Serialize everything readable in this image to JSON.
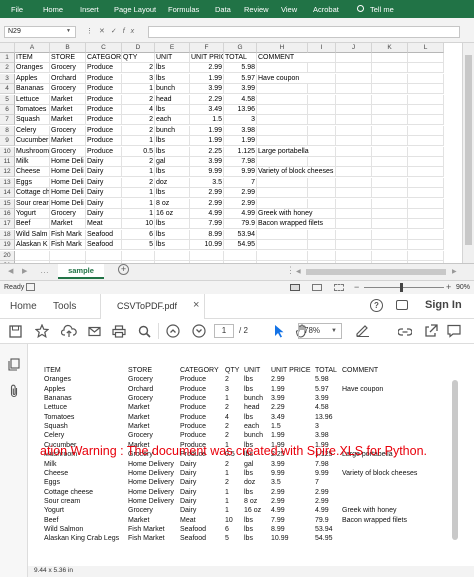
{
  "excel": {
    "ribbon_tabs": [
      "File",
      "Home",
      "Insert",
      "Page Layout",
      "Formulas",
      "Data",
      "Review",
      "View",
      "Acrobat"
    ],
    "tell_me": "Tell me",
    "name_box": "N29",
    "columns": [
      "A",
      "B",
      "C",
      "D",
      "E",
      "F",
      "G",
      "H",
      "I",
      "J",
      "K",
      "L"
    ],
    "row_numbers": [
      "1",
      "2",
      "3",
      "4",
      "5",
      "6",
      "7",
      "8",
      "9",
      "10",
      "11",
      "12",
      "13",
      "14",
      "15",
      "16",
      "17",
      "18",
      "19",
      "20",
      "21"
    ],
    "rows": [
      [
        "ITEM",
        "STORE",
        "CATEGORY",
        "QTY",
        "UNIT",
        "UNIT PRICE",
        "TOTAL",
        "COMMENT"
      ],
      [
        "Oranges",
        "Grocery",
        "Produce",
        "2",
        "lbs",
        "2.99",
        "5.98",
        ""
      ],
      [
        "Apples",
        "Orchard",
        "Produce",
        "3",
        "lbs",
        "1.99",
        "5.97",
        "Have coupon"
      ],
      [
        "Bananas",
        "Grocery",
        "Produce",
        "1",
        "bunch",
        "3.99",
        "3.99",
        ""
      ],
      [
        "Lettuce",
        "Market",
        "Produce",
        "2",
        "head",
        "2.29",
        "4.58",
        ""
      ],
      [
        "Tomatoes",
        "Market",
        "Produce",
        "4",
        "lbs",
        "3.49",
        "13.96",
        ""
      ],
      [
        "Squash",
        "Market",
        "Produce",
        "2",
        "each",
        "1.5",
        "3",
        ""
      ],
      [
        "Celery",
        "Grocery",
        "Produce",
        "2",
        "bunch",
        "1.99",
        "3.98",
        ""
      ],
      [
        "Cucumber",
        "Market",
        "Produce",
        "1",
        "lbs",
        "1.99",
        "1.99",
        ""
      ],
      [
        "Mushroom",
        "Grocery",
        "Produce",
        "0.5",
        "lbs",
        "2.25",
        "1.125",
        "Large portabella"
      ],
      [
        "Milk",
        "Home Deli",
        "Dairy",
        "2",
        "gal",
        "3.99",
        "7.98",
        ""
      ],
      [
        "Cheese",
        "Home Deli",
        "Dairy",
        "1",
        "lbs",
        "9.99",
        "9.99",
        "Variety of block cheeses"
      ],
      [
        "Eggs",
        "Home Deli",
        "Dairy",
        "2",
        "doz",
        "3.5",
        "7",
        ""
      ],
      [
        "Cottage ch",
        "Home Deli",
        "Dairy",
        "1",
        "lbs",
        "2.99",
        "2.99",
        ""
      ],
      [
        "Sour crear",
        "Home Deli",
        "Dairy",
        "1",
        "8 oz",
        "2.99",
        "2.99",
        ""
      ],
      [
        "Yogurt",
        "Grocery",
        "Dairy",
        "1",
        "16 oz",
        "4.99",
        "4.99",
        "Greek with honey"
      ],
      [
        "Beef",
        "Market",
        "Meat",
        "10",
        "lbs",
        "7.99",
        "79.9",
        "Bacon wrapped filets"
      ],
      [
        "Wild Salm",
        "Fish Mark",
        "Seafood",
        "6",
        "lbs",
        "8.99",
        "53.94",
        ""
      ],
      [
        "Alaskan K",
        "Fish Mark",
        "Seafood",
        "5",
        "lbs",
        "10.99",
        "54.95",
        ""
      ],
      [
        "",
        "",
        "",
        "",
        "",
        "",
        "",
        ""
      ],
      [
        "",
        "",
        "",
        "",
        "",
        "",
        "",
        ""
      ]
    ],
    "sheet_tab": "sample",
    "status": "Ready",
    "zoom": "90%"
  },
  "pdf": {
    "nav": {
      "home": "Home",
      "tools": "Tools",
      "file_tab": "CSVToPDF.pdf",
      "sign_in": "Sign In"
    },
    "page_current": "1",
    "page_total": "/ 2",
    "zoom": "78%",
    "headers": [
      "ITEM",
      "STORE",
      "CATEGORY",
      "QTY",
      "UNIT",
      "UNIT PRICE",
      "TOTAL",
      "COMMENT"
    ],
    "rows": [
      [
        "Oranges",
        "Grocery",
        "Produce",
        "2",
        "lbs",
        "2.99",
        "5.98",
        ""
      ],
      [
        "Apples",
        "Orchard",
        "Produce",
        "3",
        "lbs",
        "1.99",
        "5.97",
        "Have coupon"
      ],
      [
        "Bananas",
        "Grocery",
        "Produce",
        "1",
        "bunch",
        "3.99",
        "3.99",
        ""
      ],
      [
        "Lettuce",
        "Market",
        "Produce",
        "2",
        "head",
        "2.29",
        "4.58",
        ""
      ],
      [
        "Tomatoes",
        "Market",
        "Produce",
        "4",
        "lbs",
        "3.49",
        "13.96",
        ""
      ],
      [
        "Squash",
        "Market",
        "Produce",
        "2",
        "each",
        "1.5",
        "3",
        ""
      ],
      [
        "Celery",
        "Grocery",
        "Produce",
        "2",
        "bunch",
        "1.99",
        "3.98",
        ""
      ],
      [
        "Cucumber",
        "Market",
        "Produce",
        "1",
        "lbs",
        "1.99",
        "1.99",
        ""
      ],
      [
        "Mushroom",
        "Grocery",
        "Produce",
        "0.5",
        "lbs",
        "2.25",
        "1.125",
        "Large portabella"
      ],
      [
        "Milk",
        "Home Delivery",
        "Dairy",
        "2",
        "gal",
        "3.99",
        "7.98",
        ""
      ],
      [
        "Cheese",
        "Home Delivery",
        "Dairy",
        "1",
        "lbs",
        "9.99",
        "9.99",
        "Variety of block cheeses"
      ],
      [
        "Eggs",
        "Home Delivery",
        "Dairy",
        "2",
        "doz",
        "3.5",
        "7",
        ""
      ],
      [
        "Cottage cheese",
        "Home Delivery",
        "Dairy",
        "1",
        "lbs",
        "2.99",
        "2.99",
        ""
      ],
      [
        "Sour cream",
        "Home Delivery",
        "Dairy",
        "1",
        "8 oz",
        "2.99",
        "2.99",
        ""
      ],
      [
        "Yogurt",
        "Grocery",
        "Dairy",
        "1",
        "16 oz",
        "4.99",
        "4.99",
        "Greek with honey"
      ],
      [
        "Beef",
        "Market",
        "Meat",
        "10",
        "lbs",
        "7.99",
        "79.9",
        "Bacon wrapped filets"
      ],
      [
        "Wild Salmon",
        "Fish Market",
        "Seafood",
        "6",
        "lbs",
        "8.99",
        "53.94",
        ""
      ],
      [
        "Alaskan King Crab Legs",
        "Fish Market",
        "Seafood",
        "5",
        "lbs",
        "10.99",
        "54.95",
        ""
      ]
    ],
    "warning": "ation Warning : The document was created with Spire.XLS for Python.",
    "page_size": "9.44 x 5.36 in"
  },
  "colors": {
    "excel_green": "#217346",
    "warning_red": "#e8000b",
    "select_blue": "#1473e6"
  }
}
